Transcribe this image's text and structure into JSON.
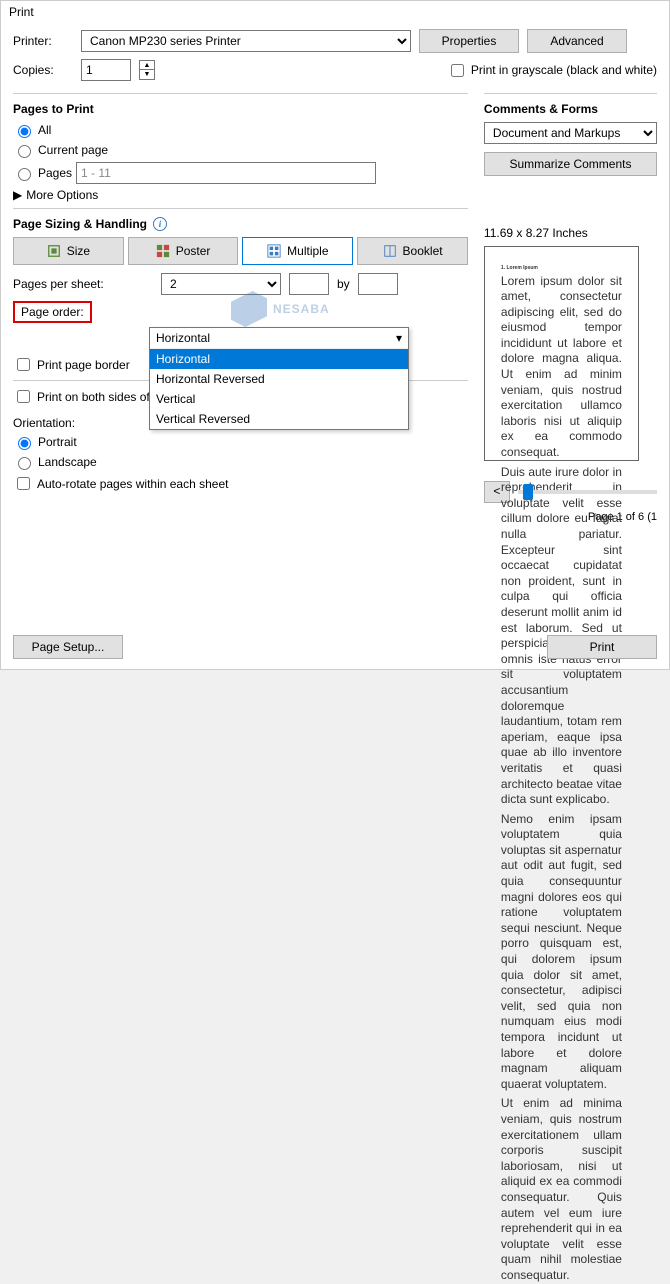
{
  "window_title": "Print",
  "printer": {
    "label": "Printer:",
    "selected": "Canon MP230 series Printer",
    "properties_btn": "Properties",
    "advanced_btn": "Advanced"
  },
  "copies": {
    "label": "Copies:",
    "value": "1"
  },
  "grayscale": {
    "label": "Print in grayscale (black and white)",
    "checked": false
  },
  "pages_to_print": {
    "title": "Pages to Print",
    "all": "All",
    "current": "Current page",
    "pages": "Pages",
    "pages_range": "1 - 11",
    "more_options": "More Options"
  },
  "comments": {
    "title": "Comments & Forms",
    "selected": "Document and Markups",
    "summarize_btn": "Summarize Comments"
  },
  "sizing": {
    "title": "Page Sizing & Handling",
    "tabs": {
      "size": "Size",
      "poster": "Poster",
      "multiple": "Multiple",
      "booklet": "Booklet"
    },
    "pages_per_sheet_label": "Pages per sheet:",
    "pages_per_sheet_value": "2",
    "by_label": "by",
    "page_order_label": "Page order:",
    "page_order_selected": "Horizontal",
    "page_order_options": [
      "Horizontal",
      "Horizontal Reversed",
      "Vertical",
      "Vertical Reversed"
    ],
    "print_page_border": "Print page border",
    "print_both_sides": "Print on both sides of",
    "orientation_label": "Orientation:",
    "portrait": "Portrait",
    "landscape": "Landscape",
    "auto_rotate": "Auto-rotate pages within each sheet"
  },
  "preview": {
    "dimensions": "11.69 x 8.27 Inches",
    "page_counter": "Page 1 of 6 (1"
  },
  "bottom": {
    "page_setup": "Page Setup...",
    "print": "Print"
  },
  "watermark": "NESABA"
}
